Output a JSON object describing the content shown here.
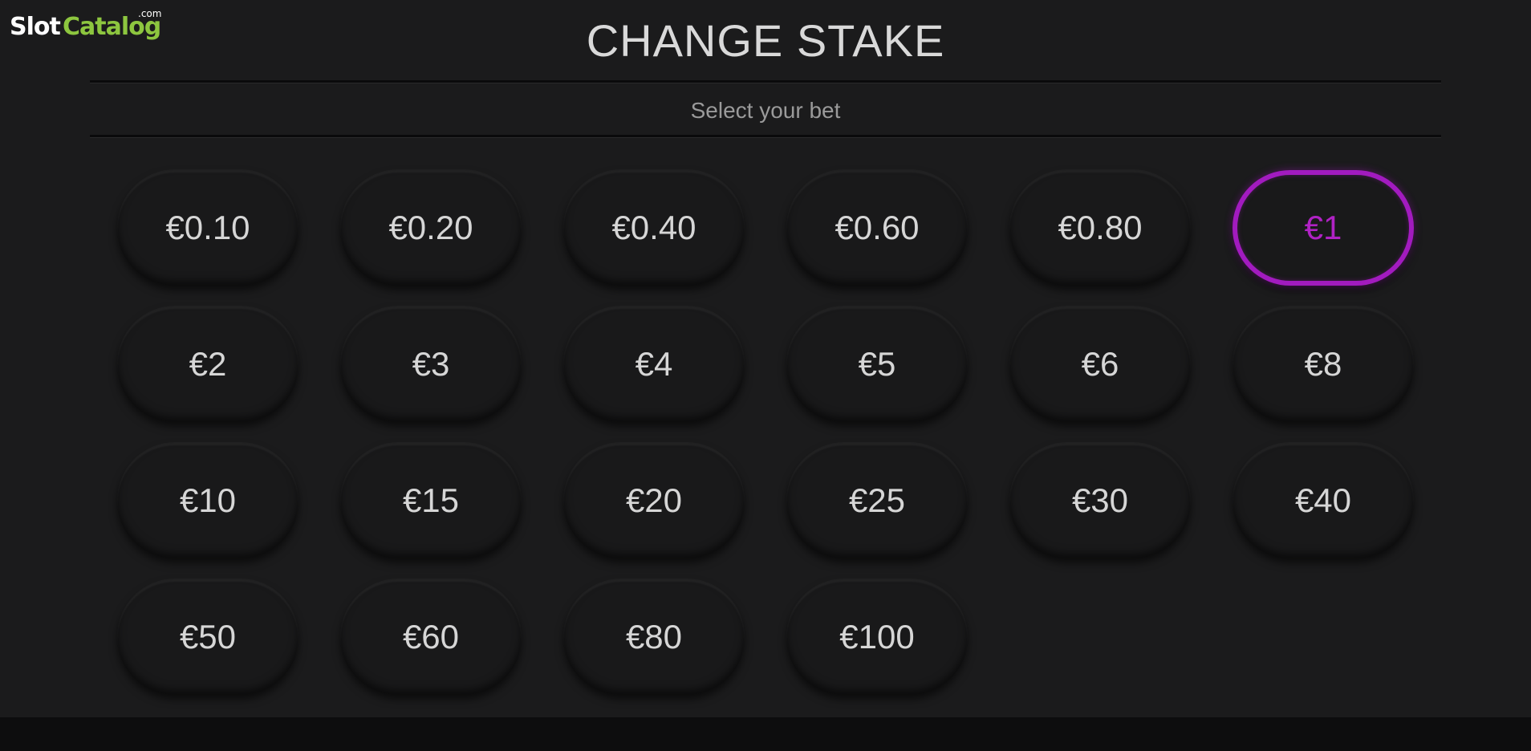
{
  "logo": {
    "slot": "Slot",
    "catalog": "Catalog",
    "com": ".com"
  },
  "header": {
    "title": "CHANGE STAKE",
    "subtitle": "Select your bet"
  },
  "colors": {
    "accent": "#a21bbf",
    "background": "#1b1b1c",
    "logo_green": "#8dc63f"
  },
  "stakes": {
    "selected": "€1",
    "items": [
      "€0.10",
      "€0.20",
      "€0.40",
      "€0.60",
      "€0.80",
      "€1",
      "€2",
      "€3",
      "€4",
      "€5",
      "€6",
      "€8",
      "€10",
      "€15",
      "€20",
      "€25",
      "€30",
      "€40",
      "€50",
      "€60",
      "€80",
      "€100"
    ]
  }
}
